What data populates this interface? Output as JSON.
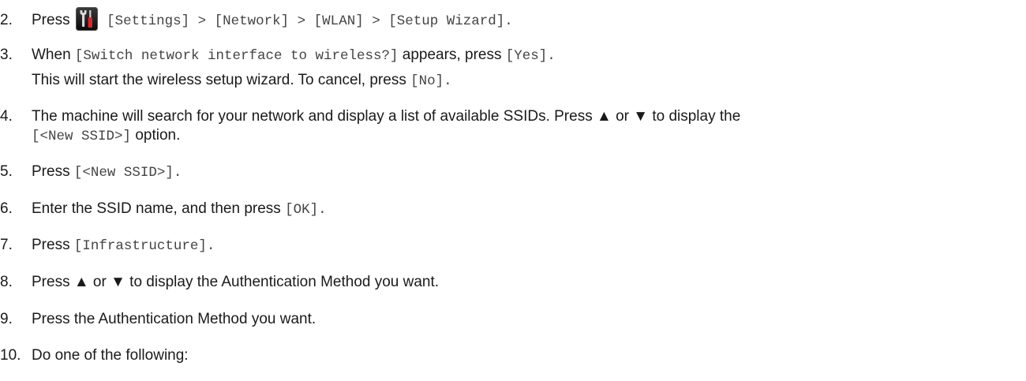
{
  "steps": [
    {
      "num": "2.",
      "press": "Press",
      "icon": "settings-tools-icon",
      "path": "[Settings] > [Network] > [WLAN] > [Setup Wizard]."
    },
    {
      "num": "3.",
      "when": "When",
      "prompt": "[Switch network interface to wireless?]",
      "appears_press": "appears, press",
      "yes": "[Yes].",
      "note": "This will start the wireless setup wizard. To cancel, press",
      "no": "[No]."
    },
    {
      "num": "4.",
      "text": "The machine will search for your network and display a list of available SSIDs. Press ▲ or ▼ to display the",
      "option": "[<New SSID>]",
      "option_suffix": "option."
    },
    {
      "num": "5.",
      "press": "Press",
      "code": "[<New SSID>]."
    },
    {
      "num": "6.",
      "text": "Enter the SSID name, and then press",
      "code": "[OK]."
    },
    {
      "num": "7.",
      "press": "Press",
      "code": "[Infrastructure]."
    },
    {
      "num": "8.",
      "text": "Press ▲ or ▼ to display the Authentication Method you want."
    },
    {
      "num": "9.",
      "text": "Press the Authentication Method you want."
    },
    {
      "num": "10.",
      "text": "Do one of the following:"
    }
  ]
}
